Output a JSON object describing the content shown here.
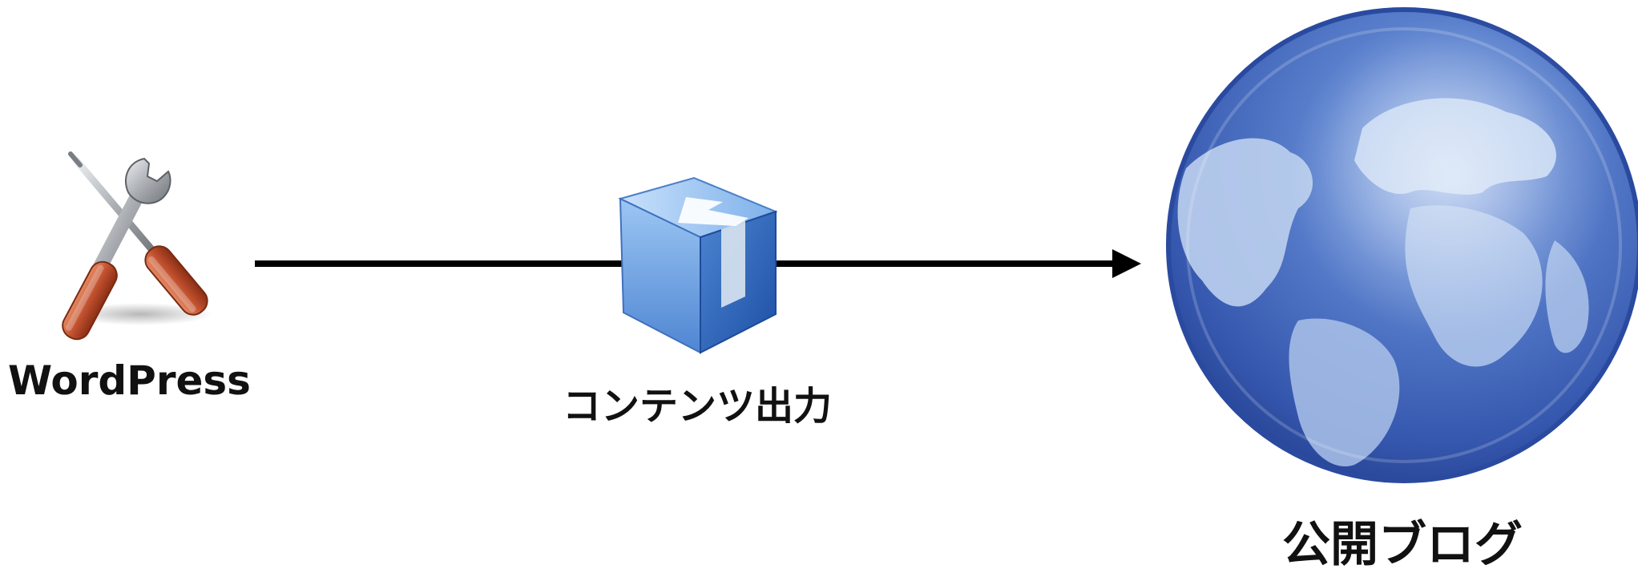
{
  "nodes": {
    "source": {
      "label": "WordPress",
      "icon": "wrench-screwdriver-icon"
    },
    "process": {
      "label": "コンテンツ出力",
      "icon": "export-box-icon"
    },
    "target": {
      "label": "公開ブログ",
      "icon": "globe-icon"
    }
  },
  "edges": [
    {
      "from": "source",
      "to": "target",
      "arrowhead": "end"
    }
  ],
  "colors": {
    "arrow": "#000000",
    "globe_ocean": "#3b5fb8",
    "globe_land": "#bcd0ee",
    "box_blue": "#6aa3e3",
    "tool_handle": "#c0502e",
    "tool_metal": "#b0b4b8"
  }
}
